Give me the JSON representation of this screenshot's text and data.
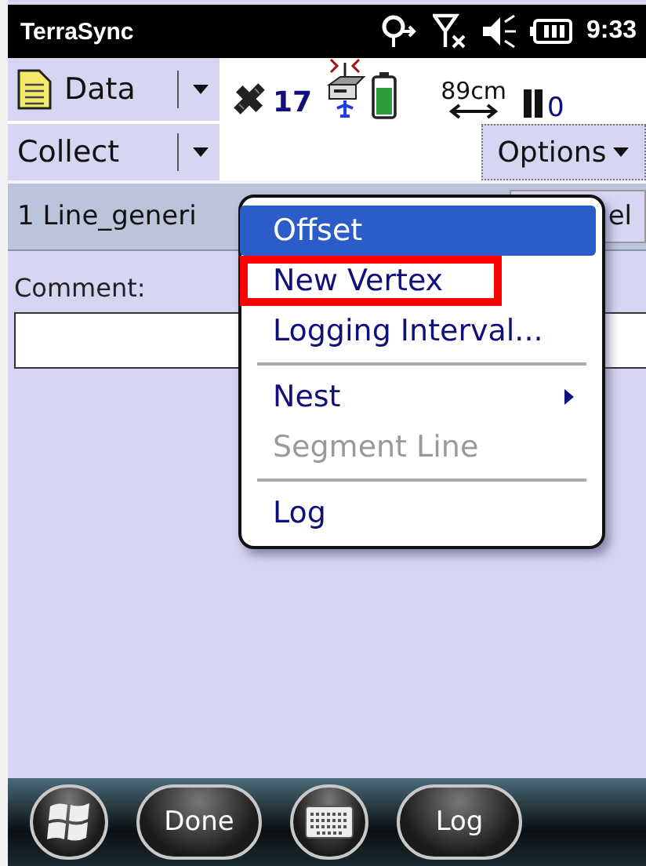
{
  "title_bar": {
    "app": "TerraSync",
    "time": "9:33"
  },
  "toolbar": {
    "section_menu": "Data",
    "satellites": "17",
    "accuracy": "89cm",
    "logging_count": "0"
  },
  "command_bar": {
    "mode_menu": "Collect",
    "options_button": "Options"
  },
  "feature_bar": {
    "feature": "1 Line_generi",
    "button": "el"
  },
  "form": {
    "comment_label": "Comment:"
  },
  "options_menu": [
    {
      "kind": "item",
      "label": "Offset",
      "selected": true,
      "disabled": false,
      "highlighted": false,
      "submenu": false
    },
    {
      "kind": "item",
      "label": "New Vertex",
      "selected": false,
      "disabled": false,
      "highlighted": true,
      "submenu": false
    },
    {
      "kind": "item",
      "label": "Logging Interval...",
      "selected": false,
      "disabled": false,
      "highlighted": false,
      "submenu": false
    },
    {
      "kind": "separator"
    },
    {
      "kind": "item",
      "label": "Nest",
      "selected": false,
      "disabled": false,
      "highlighted": false,
      "submenu": true
    },
    {
      "kind": "item",
      "label": "Segment Line",
      "selected": false,
      "disabled": true,
      "highlighted": false,
      "submenu": false
    },
    {
      "kind": "separator"
    },
    {
      "kind": "item",
      "label": "Log",
      "selected": false,
      "disabled": false,
      "highlighted": false,
      "submenu": false
    }
  ],
  "taskbar": [
    {
      "kind": "start"
    },
    {
      "kind": "text",
      "label": "Done"
    },
    {
      "kind": "keyboard"
    },
    {
      "kind": "text",
      "label": "Log"
    }
  ]
}
